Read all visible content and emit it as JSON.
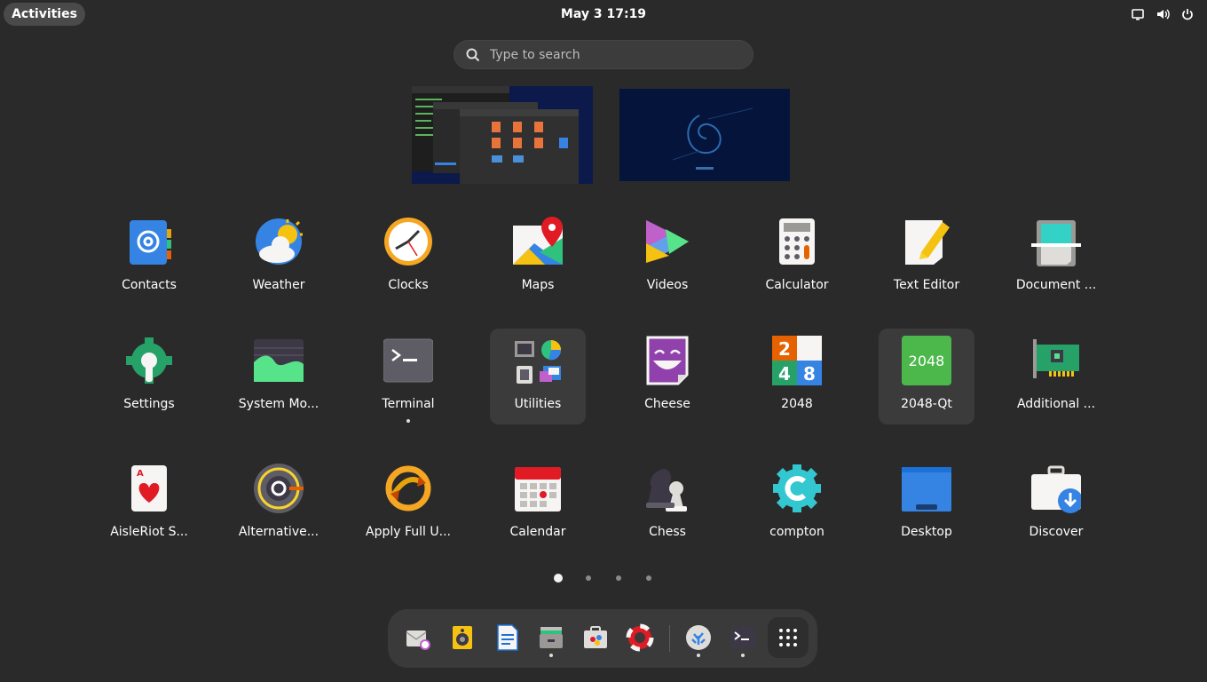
{
  "topbar": {
    "activities": "Activities",
    "clock": "May 3  17:19"
  },
  "search": {
    "placeholder": "Type to search"
  },
  "apps": [
    {
      "label": "Contacts",
      "icon": "contacts-icon"
    },
    {
      "label": "Weather",
      "icon": "weather-icon"
    },
    {
      "label": "Clocks",
      "icon": "clocks-icon"
    },
    {
      "label": "Maps",
      "icon": "maps-icon"
    },
    {
      "label": "Videos",
      "icon": "videos-icon"
    },
    {
      "label": "Calculator",
      "icon": "calculator-icon"
    },
    {
      "label": "Text Editor",
      "icon": "text-editor-icon"
    },
    {
      "label": "Document ...",
      "icon": "document-scanner-icon"
    },
    {
      "label": "Settings",
      "icon": "settings-icon"
    },
    {
      "label": "System Mo...",
      "icon": "system-monitor-icon"
    },
    {
      "label": "Terminal",
      "icon": "terminal-icon"
    },
    {
      "label": "Utilities",
      "icon": "utilities-folder-icon"
    },
    {
      "label": "Cheese",
      "icon": "cheese-icon"
    },
    {
      "label": "2048",
      "icon": "2048-icon",
      "tiles": [
        "2",
        "4",
        "8"
      ]
    },
    {
      "label": "2048-Qt",
      "icon": "2048-qt-icon",
      "tile": "2048"
    },
    {
      "label": "Additional ...",
      "icon": "additional-drivers-icon"
    },
    {
      "label": "AisleRiot S...",
      "icon": "aisleriot-icon"
    },
    {
      "label": "Alternative...",
      "icon": "alternative-icon"
    },
    {
      "label": "Apply Full U...",
      "icon": "apply-full-upgrade-icon"
    },
    {
      "label": "Calendar",
      "icon": "calendar-icon"
    },
    {
      "label": "Chess",
      "icon": "chess-icon"
    },
    {
      "label": "compton",
      "icon": "compton-icon"
    },
    {
      "label": "Desktop",
      "icon": "desktop-icon"
    },
    {
      "label": "Discover",
      "icon": "discover-icon"
    }
  ],
  "pager": {
    "pages": 4,
    "active": 1
  },
  "dash": [
    {
      "name": "mail-icon"
    },
    {
      "name": "rhythmbox-icon"
    },
    {
      "name": "writer-icon"
    },
    {
      "name": "files-icon",
      "running": true
    },
    {
      "name": "software-icon"
    },
    {
      "name": "help-icon"
    },
    {
      "name": "debian-icon",
      "running": true
    },
    {
      "name": "terminal-icon",
      "running": true
    },
    {
      "name": "show-apps-icon"
    }
  ],
  "colors": {
    "background": "#2a2a2a",
    "accent_blue": "#3584e4",
    "accent_orange": "#f5a623"
  }
}
